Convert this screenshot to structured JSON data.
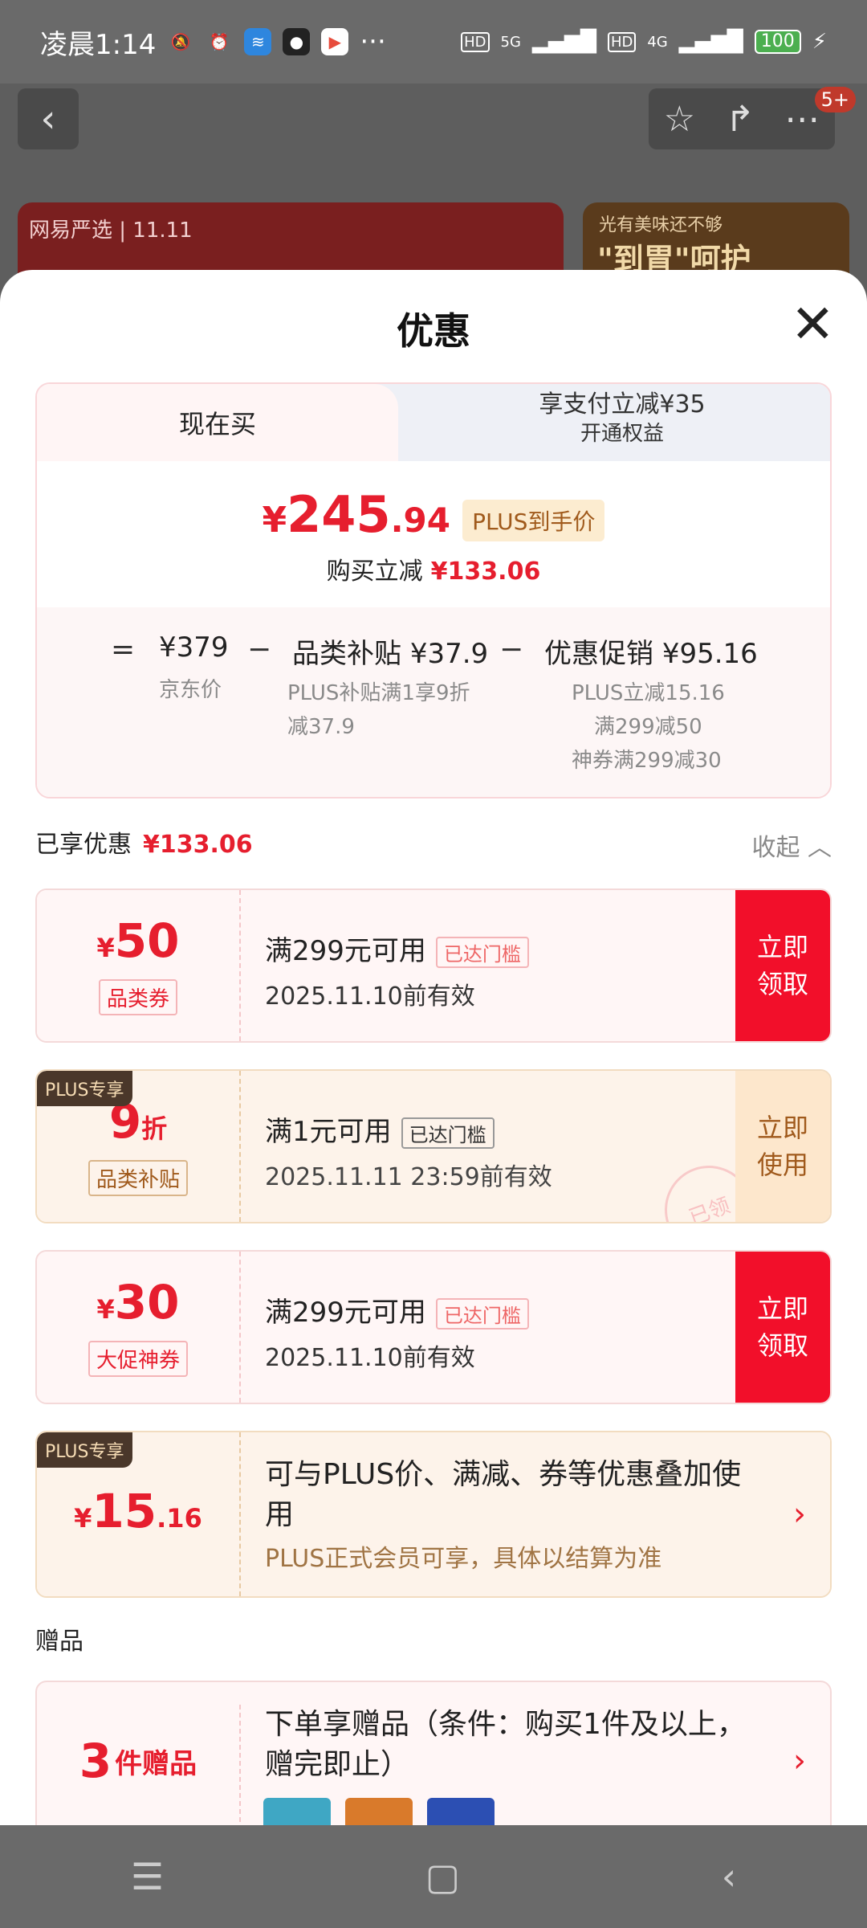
{
  "status_bar": {
    "time": "凌晨1:14",
    "more": "···",
    "hd1": "HD",
    "net1": "5G",
    "hd2": "HD",
    "net2": "4G",
    "battery": "100"
  },
  "background": {
    "badge": "5+",
    "card_left_text": "网易严选 | 11.11",
    "card_right_top": "光有美味还不够",
    "card_right_main": "\"到胃\"呵护"
  },
  "sheet": {
    "title": "优惠",
    "tabs": {
      "now": "现在买",
      "pay_title": "享支付立减¥35",
      "pay_sub": "开通权益"
    },
    "price": {
      "currency": "¥",
      "integer": "245",
      "decimal": ".94",
      "plus_tag": "PLUS到手价",
      "reduce_label": "购买立减",
      "reduce_value": "¥133.06"
    },
    "calc": {
      "eq": "=",
      "minus": "−",
      "jd_price": "¥379",
      "jd_label": "京东价",
      "subsidy_label": "品类补贴",
      "subsidy_value": "¥37.9",
      "subsidy_detail1": "PLUS补贴满1享9折",
      "subsidy_detail2": "减37.9",
      "promo_label": "优惠促销",
      "promo_value": "¥95.16",
      "promo_detail1": "PLUS立减15.16",
      "promo_detail2": "满299减50",
      "promo_detail3": "神券满299减30"
    },
    "enjoyed": {
      "label": "已享优惠",
      "value": "¥133.06",
      "collapse": "收起 ︿"
    },
    "coupons": [
      {
        "symbol": "¥",
        "amount": "50",
        "type": "品类券",
        "condition": "满299元可用",
        "threshold": "已达门槛",
        "valid": "2025.11.10前有效",
        "button": "立即领取"
      },
      {
        "plus": "PLUS专享",
        "amount": "9",
        "unit": "折",
        "type": "品类补贴",
        "condition": "满1元可用",
        "threshold": "已达门槛",
        "valid": "2025.11.11 23:59前有效",
        "button": "立即使用",
        "stamp": "已领"
      },
      {
        "symbol": "¥",
        "amount": "30",
        "type": "大促神券",
        "condition": "满299元可用",
        "threshold": "已达门槛",
        "valid": "2025.11.10前有效",
        "button": "立即领取"
      }
    ],
    "plus_offer": {
      "plus": "PLUS专享",
      "symbol": "¥",
      "amount": "15",
      "decimal": ".16",
      "title": "可与PLUS价、满减、券等优惠叠加使用",
      "note": "PLUS正式会员可享，具体以结算为准",
      "chevron": "›"
    },
    "gift": {
      "section_title": "赠品",
      "count": "3",
      "count_label": "件赠品",
      "text": "下单享赠品（条件：购买1件及以上，赠完即止）",
      "chevron": "›"
    }
  },
  "nav_bar": {
    "menu": "☰",
    "home": "▢",
    "back": "‹"
  },
  "colors": {
    "accent_red": "#e61e2e",
    "button_red": "#f20f2a",
    "plus_gold": "#a05a1c"
  }
}
